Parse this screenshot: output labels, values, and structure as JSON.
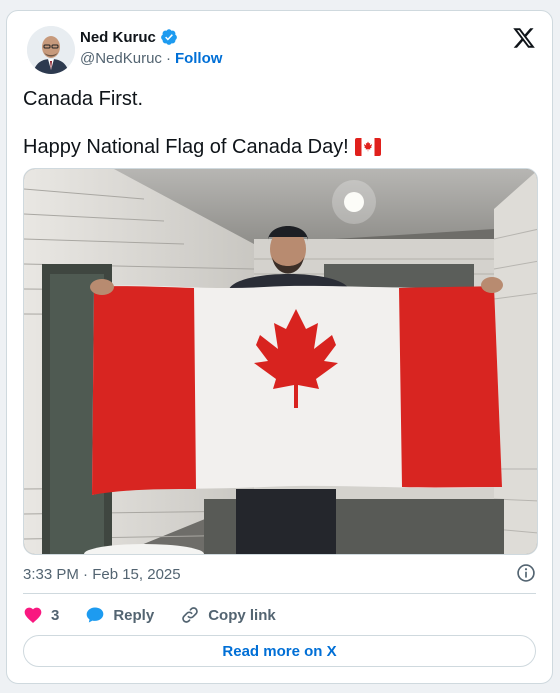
{
  "author": {
    "name": "Ned Kuruc",
    "handle": "@NedKuruc",
    "separator": "·",
    "follow_label": "Follow"
  },
  "tweet": {
    "line1": "Canada First.",
    "line2": "Happy National Flag of Canada Day!",
    "emoji": "flag-canada"
  },
  "timestamp": "3:33 PM · Feb 15, 2025",
  "actions": {
    "like_count": "3",
    "reply_label": "Reply",
    "copy_link_label": "Copy link"
  },
  "read_more_label": "Read more on X",
  "colors": {
    "link_blue": "#006fd6",
    "verified_blue": "#1d9bf0",
    "like_pink": "#f91880",
    "reply_blue": "#1d9bf0",
    "flag_red": "#e0201c"
  },
  "icons": [
    "verified-badge-icon",
    "x-logo-icon",
    "info-icon",
    "heart-icon",
    "reply-bubble-icon",
    "link-icon"
  ]
}
